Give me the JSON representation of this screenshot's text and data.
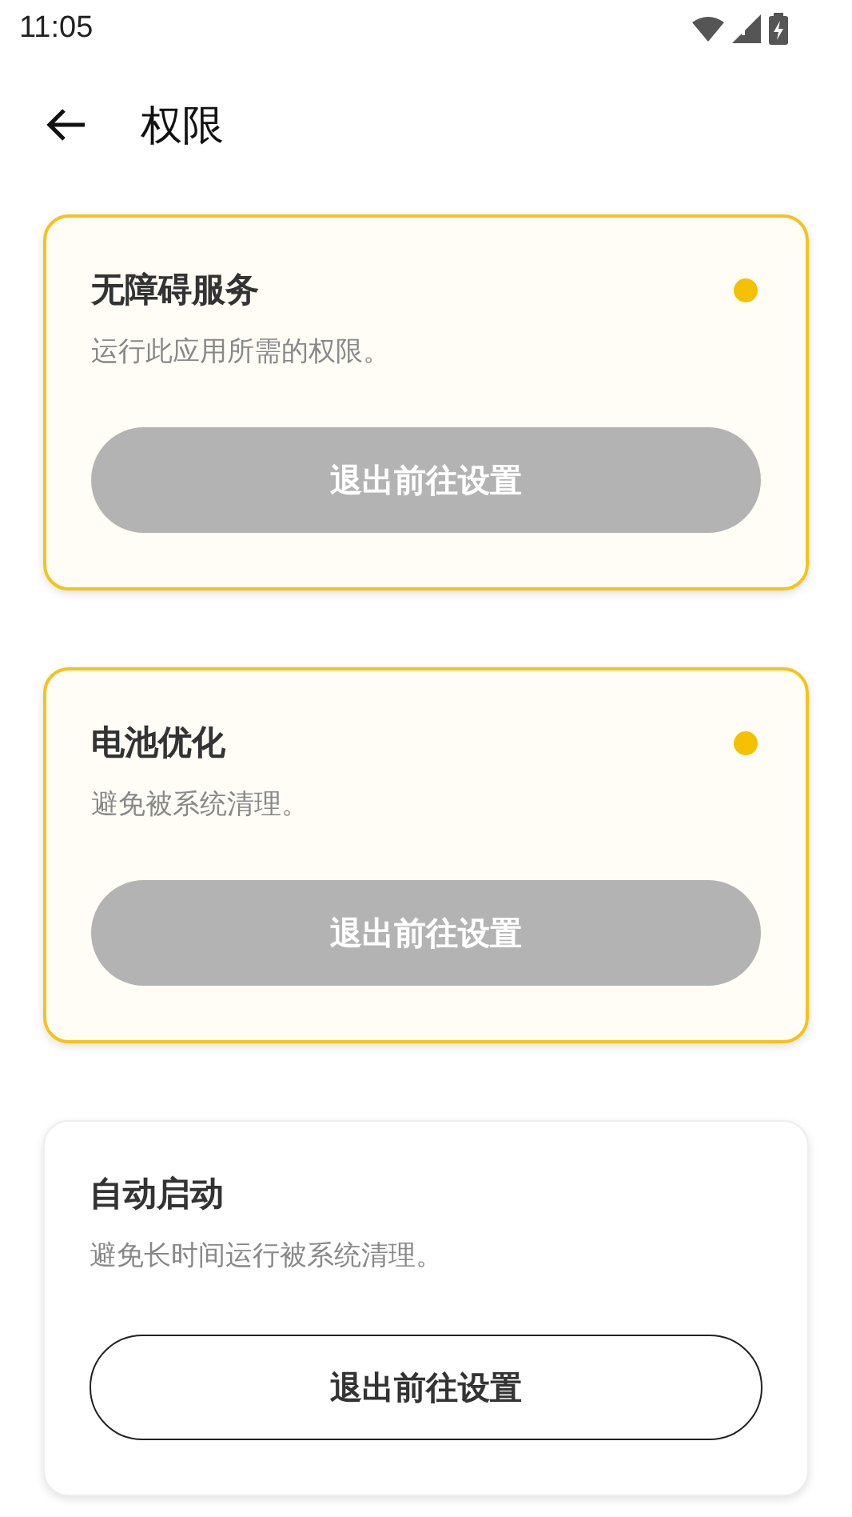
{
  "status_bar": {
    "time": "11:05"
  },
  "header": {
    "title": "权限"
  },
  "cards": [
    {
      "title": "无障碍服务",
      "description": "运行此应用所需的权限。",
      "button": "退出前往设置",
      "granted": false
    },
    {
      "title": "电池优化",
      "description": "避免被系统清理。",
      "button": "退出前往设置",
      "granted": false
    },
    {
      "title": "自动启动",
      "description": "避免长时间运行被系统清理。",
      "button": "退出前往设置",
      "granted": true
    }
  ]
}
